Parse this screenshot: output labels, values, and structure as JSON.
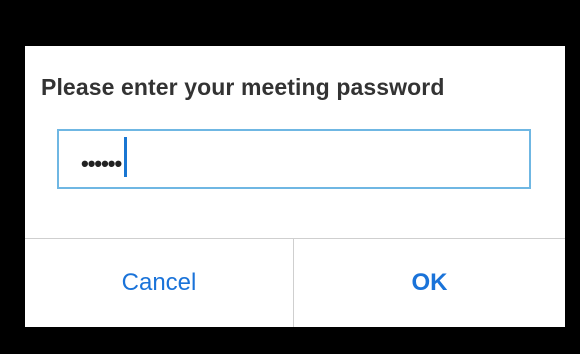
{
  "dialog": {
    "title": "Please enter your meeting password",
    "password_value": "••••••",
    "cancel_label": "Cancel",
    "ok_label": "OK"
  },
  "colors": {
    "accent": "#1a73d9",
    "field_border": "#6fb7e3",
    "backdrop": "#000000"
  }
}
